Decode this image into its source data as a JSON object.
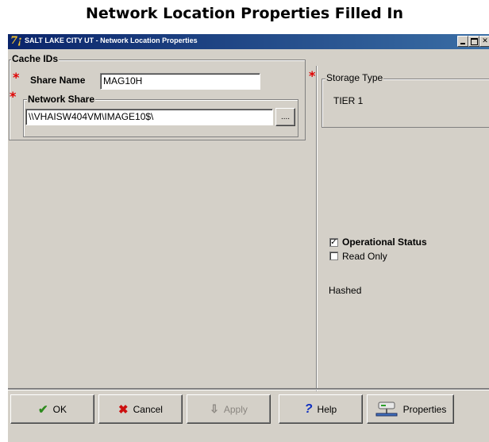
{
  "page_title": "Network Location Properties Filled In",
  "window": {
    "title": "SALT LAKE CITY UT  -  Network Location Properties",
    "app_icon_glyph": "7¡"
  },
  "cache_ids": {
    "legend": "Cache IDs",
    "share_name_label": "Share Name",
    "share_name_value": "MAG10H",
    "network_share_legend": "Network Share",
    "network_share_value": "\\\\VHAISW404VM\\IMAGE10$\\",
    "browse_label": "...."
  },
  "storage": {
    "legend": "Storage Type",
    "value": "TIER 1"
  },
  "options": {
    "operational_status_label": "Operational Status",
    "operational_status_checked": true,
    "read_only_label": "Read Only",
    "read_only_checked": false,
    "hashed_label": "Hashed"
  },
  "buttons": {
    "ok": "OK",
    "cancel": "Cancel",
    "apply": "Apply",
    "help": "Help",
    "properties": "Properties"
  },
  "required_marker": "*",
  "colors": {
    "titlebar_start": "#0a246a",
    "titlebar_end": "#3a6ea5",
    "window_bg": "#d4d0c8",
    "required": "#e00000",
    "ok_check": "#2e8b1e",
    "cancel_x": "#cc1010",
    "help_q": "#1030c0"
  }
}
